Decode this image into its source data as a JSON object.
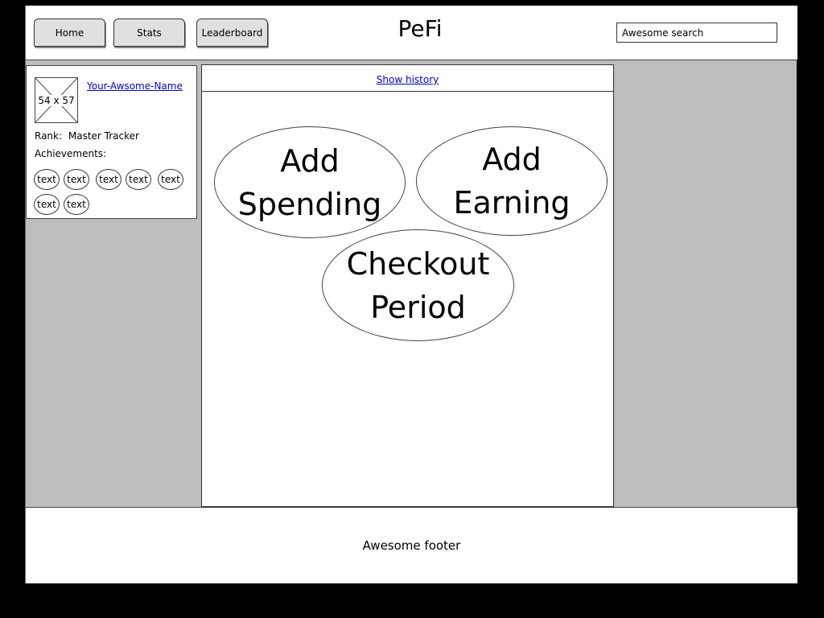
{
  "header": {
    "nav": [
      {
        "label": "Home"
      },
      {
        "label": "Stats"
      },
      {
        "label": "Leaderboard"
      }
    ],
    "title": "PeFi",
    "search_value": "Awesome search"
  },
  "profile": {
    "avatar_label": "54 x 57",
    "name": "Your-Awsome-Name",
    "rank_label": "Rank:",
    "rank_value": "Master Tracker",
    "achievements_label": "Achievements:",
    "badges": [
      "text",
      "text",
      "text",
      "text",
      "text",
      "text",
      "text"
    ]
  },
  "main": {
    "history_link": "Show history",
    "actions": [
      {
        "line1": "Add",
        "line2": "Spending"
      },
      {
        "line1": "Add",
        "line2": "Earning"
      },
      {
        "line1": "Checkout",
        "line2": "Period"
      }
    ]
  },
  "footer": {
    "text": "Awesome footer"
  }
}
